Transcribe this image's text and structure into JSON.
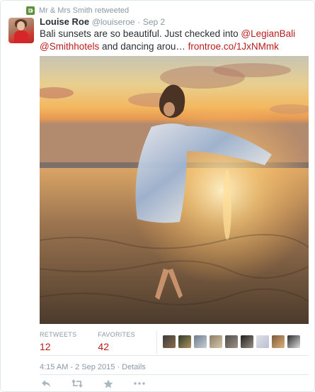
{
  "retweet_context": {
    "text": "Mr & Mrs Smith retweeted",
    "icon": "retweet-icon"
  },
  "tweet": {
    "author_name": "Louise Roe",
    "author_handle": "@louiseroe",
    "separator": "·",
    "date": "Sep 2",
    "text_plain_1": "Bali sunsets are so beautiful. Just checked into ",
    "mention_1": "@LegianBali",
    "mention_2": "@Smithhotels",
    "text_plain_2": " and dancing arou… ",
    "link": "frontroe.co/1JxNMmk"
  },
  "stats": {
    "retweets_label": "RETWEETS",
    "retweets_value": "12",
    "favorites_label": "FAVORITES",
    "favorites_value": "42"
  },
  "timestamp": "4:15 AM - 2 Sep 2015 · Details",
  "actions": [
    "reply-icon",
    "retweet-icon",
    "favorite-icon",
    "more-icon"
  ],
  "colors": {
    "link": "#b91c1c",
    "muted": "#8899a6",
    "retweet_green": "#5c913b"
  }
}
